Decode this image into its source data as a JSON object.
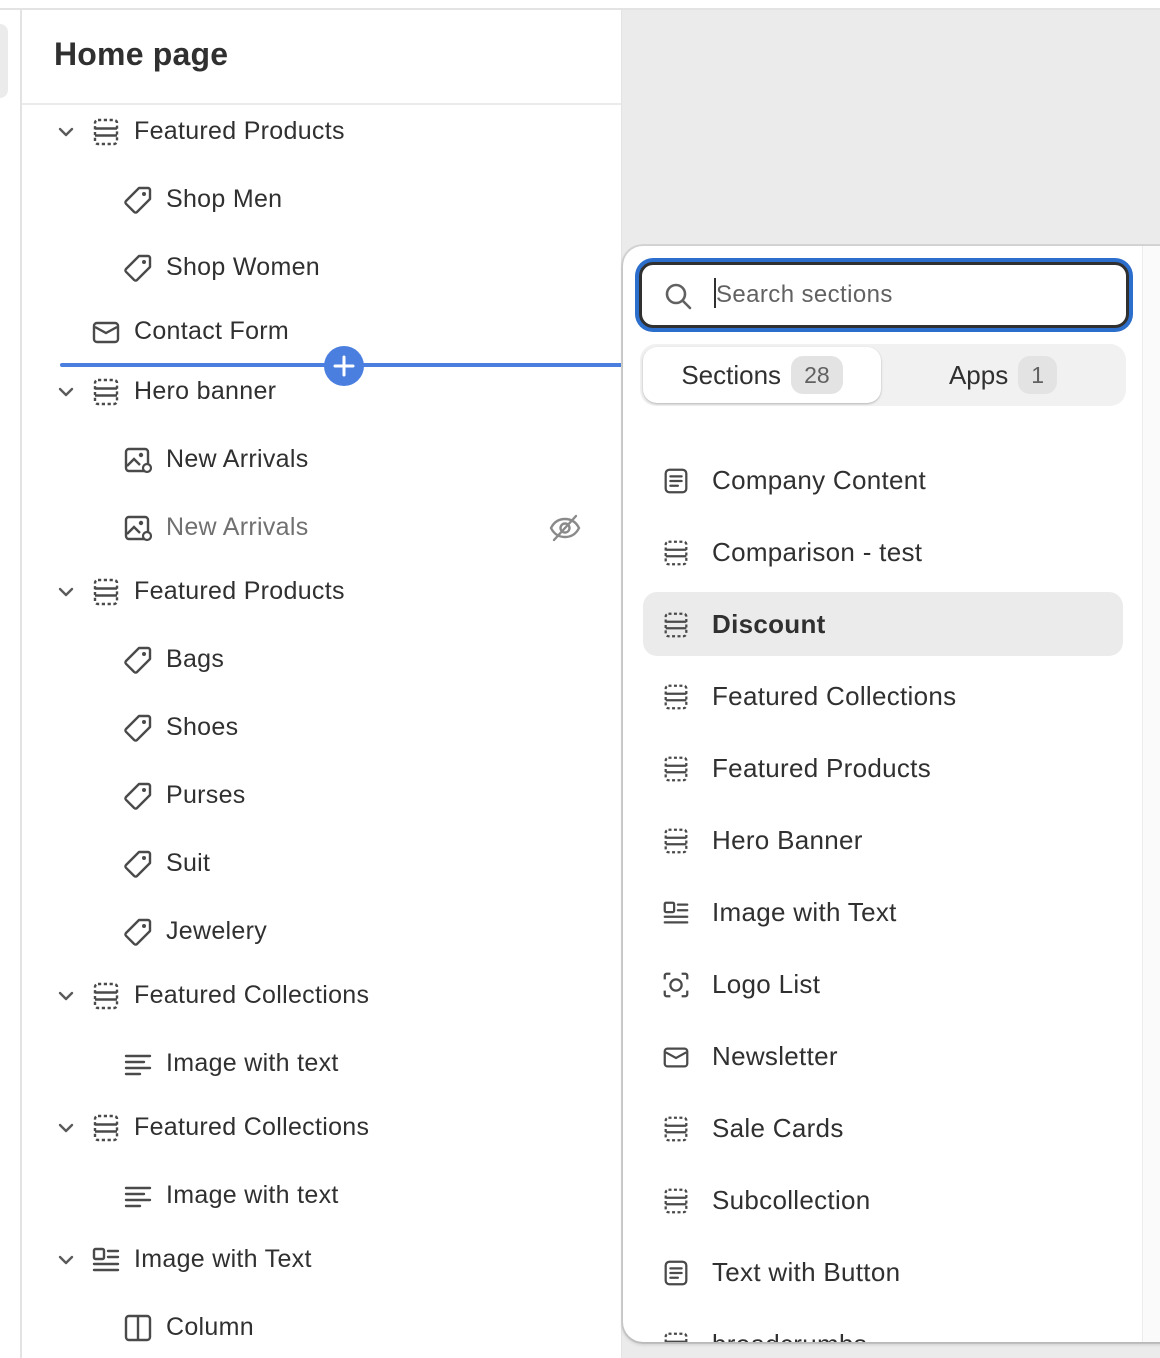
{
  "panel": {
    "title": "Home page",
    "tree": [
      {
        "label": "Featured Products",
        "level": 0,
        "icon": "section-icon",
        "chevron": true
      },
      {
        "label": "Shop Men",
        "level": 1,
        "icon": "tag-icon"
      },
      {
        "label": "Shop Women",
        "level": 1,
        "icon": "tag-icon"
      },
      {
        "label": "Contact Form",
        "level": 0,
        "icon": "email-icon",
        "chevron": false
      },
      {
        "label": "Hero banner",
        "level": 0,
        "icon": "section-icon",
        "chevron": true
      },
      {
        "label": "New Arrivals",
        "level": 1,
        "icon": "image-icon"
      },
      {
        "label": "New Arrivals",
        "level": 1,
        "icon": "image-icon",
        "hidden": true
      },
      {
        "label": "Featured Products",
        "level": 0,
        "icon": "section-icon",
        "chevron": true
      },
      {
        "label": "Bags",
        "level": 1,
        "icon": "tag-icon"
      },
      {
        "label": "Shoes",
        "level": 1,
        "icon": "tag-icon"
      },
      {
        "label": "Purses",
        "level": 1,
        "icon": "tag-icon"
      },
      {
        "label": "Suit",
        "level": 1,
        "icon": "tag-icon"
      },
      {
        "label": "Jewelery",
        "level": 1,
        "icon": "tag-icon"
      },
      {
        "label": "Featured Collections",
        "level": 0,
        "icon": "section-icon",
        "chevron": true
      },
      {
        "label": "Image with text",
        "level": 1,
        "icon": "text-align-icon"
      },
      {
        "label": "Featured Collections",
        "level": 0,
        "icon": "section-icon",
        "chevron": true
      },
      {
        "label": "Image with text",
        "level": 1,
        "icon": "text-align-icon"
      },
      {
        "label": "Image with Text",
        "level": 0,
        "icon": "image-text-icon",
        "chevron": true
      },
      {
        "label": "Column",
        "level": 1,
        "icon": "column-icon"
      }
    ]
  },
  "picker": {
    "search": {
      "placeholder": "Search sections",
      "value": ""
    },
    "tabs": [
      {
        "label": "Sections",
        "count": "28",
        "active": true
      },
      {
        "label": "Apps",
        "count": "1",
        "active": false
      }
    ],
    "sections": [
      {
        "label": "Company Content",
        "icon": "text-block-icon"
      },
      {
        "label": "Comparison - test",
        "icon": "section-icon"
      },
      {
        "label": "Discount",
        "icon": "section-icon",
        "hovered": true
      },
      {
        "label": "Featured Collections",
        "icon": "section-icon"
      },
      {
        "label": "Featured Products",
        "icon": "section-icon"
      },
      {
        "label": "Hero Banner",
        "icon": "section-icon"
      },
      {
        "label": "Image with Text",
        "icon": "image-text-icon"
      },
      {
        "label": "Logo List",
        "icon": "logo-icon"
      },
      {
        "label": "Newsletter",
        "icon": "email-icon"
      },
      {
        "label": "Sale Cards",
        "icon": "section-icon"
      },
      {
        "label": "Subcollection",
        "icon": "section-icon"
      },
      {
        "label": "Text with Button",
        "icon": "text-block-icon"
      },
      {
        "label": "breadcrumbs",
        "icon": "section-icon"
      }
    ]
  },
  "colors": {
    "accent": "#4a7fe0",
    "focus": "#2c6ecb",
    "text": "#303030",
    "muted": "#707070"
  }
}
